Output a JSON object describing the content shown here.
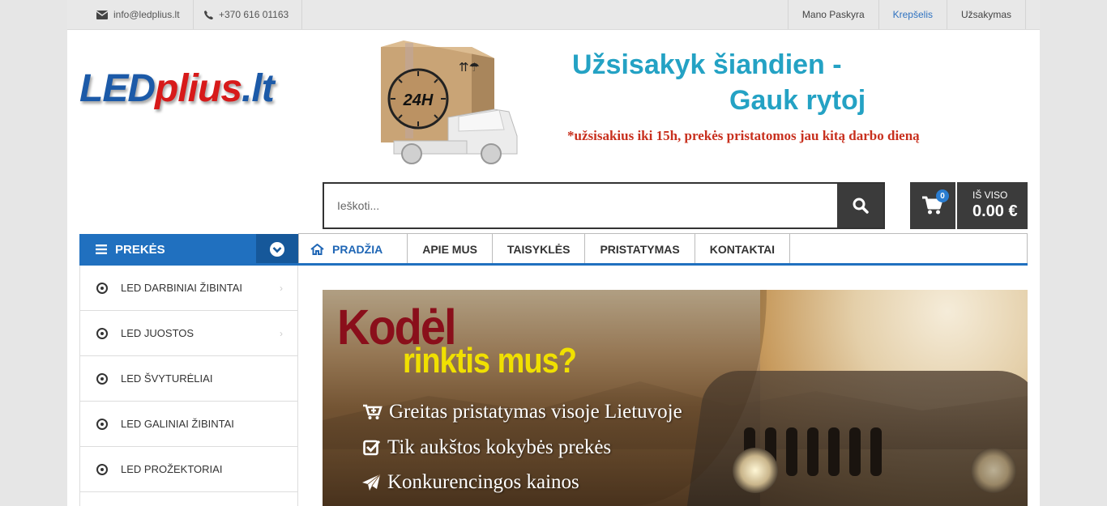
{
  "topbar": {
    "email": "info@ledplius.lt",
    "phone": "+370 616 01163",
    "links": [
      {
        "label": "Mano Paskyra",
        "active": false
      },
      {
        "label": "Krepšelis",
        "active": true
      },
      {
        "label": "Užsakymas",
        "active": false
      }
    ]
  },
  "logo": {
    "part1": "LED",
    "part2": "plius",
    "part3": ".lt"
  },
  "banner": {
    "line1": "Užsisakyk šiandien -",
    "line2": "Gauk rytoj",
    "note": "*užsisakius iki 15h, prekės pristatomos jau kitą darbo dieną",
    "box_label": "24H"
  },
  "search": {
    "placeholder": "Ieškoti..."
  },
  "cart": {
    "count": "0",
    "total_label": "IŠ VISO",
    "total_value": "0.00 €"
  },
  "categories": {
    "title": "PREKĖS",
    "items": [
      {
        "label": "LED DARBINIAI ŽIBINTAI"
      },
      {
        "label": "LED JUOSTOS"
      },
      {
        "label": "LED ŠVYTURĖLIAI"
      },
      {
        "label": "LED GALINIAI ŽIBINTAI"
      },
      {
        "label": "LED PROŽEKTORIAI"
      }
    ]
  },
  "nav": {
    "items": [
      {
        "label": "PRADŽIA"
      },
      {
        "label": "APIE MUS"
      },
      {
        "label": "TAISYKLĖS"
      },
      {
        "label": "PRISTATYMAS"
      },
      {
        "label": "KONTAKTAI"
      }
    ]
  },
  "hero": {
    "title1": "Kodėl",
    "title2": "rinktis mus?",
    "lines": [
      {
        "text": "Greitas pristatymas visoje Lietuvoje",
        "icon": "cart-plus-icon"
      },
      {
        "text": "Tik aukštos kokybės prekės",
        "icon": "check-square-icon"
      },
      {
        "text": "Konkurencingos kainos",
        "icon": "paper-plane-icon"
      }
    ]
  },
  "colors": {
    "accent": "#2070bf",
    "dark": "#3b3b3b",
    "brand_red": "#d71a1a",
    "teal": "#24a2c4"
  }
}
